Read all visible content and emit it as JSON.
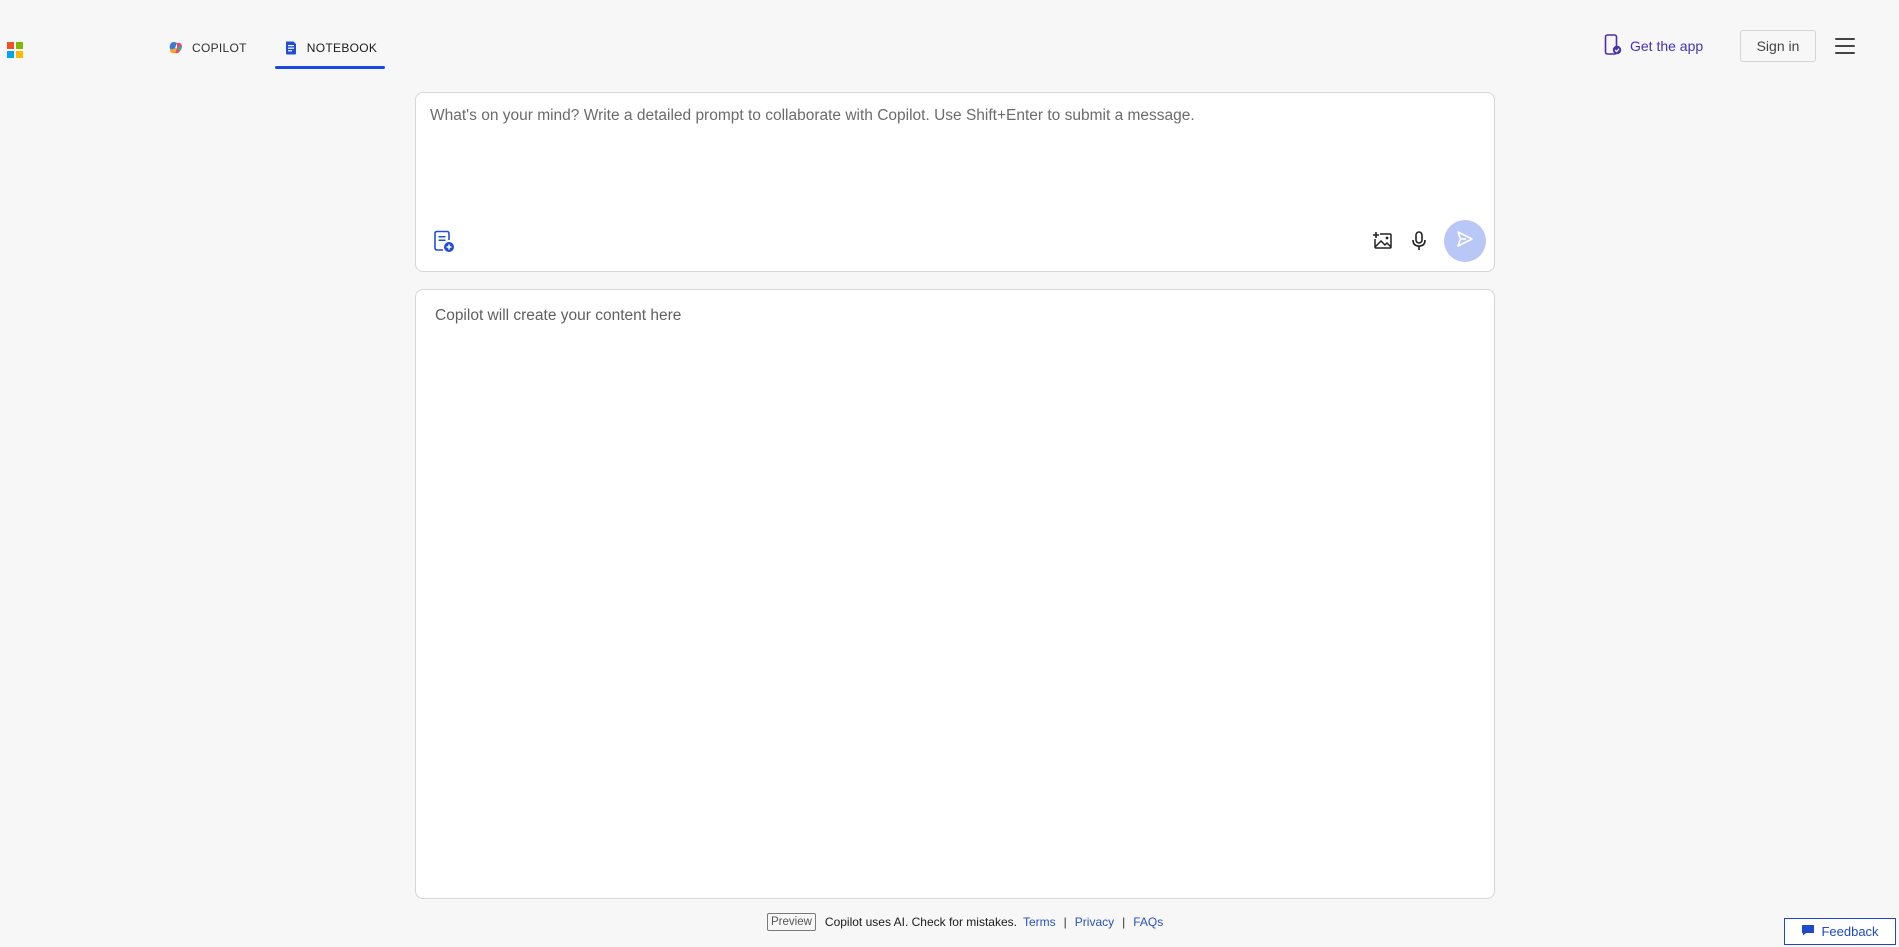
{
  "header": {
    "logo_colors": [
      "#f25022",
      "#7fba00",
      "#00a4ef",
      "#ffb900"
    ],
    "tabs": [
      {
        "label": "COPILOT",
        "icon": "copilot-icon",
        "active": false
      },
      {
        "label": "NOTEBOOK",
        "icon": "notebook-icon",
        "active": true
      }
    ],
    "get_app_label": "Get the app",
    "sign_in_label": "Sign in"
  },
  "prompt": {
    "placeholder": "What's on your mind? Write a detailed prompt to collaborate with Copilot. Use Shift+Enter to submit a message.",
    "value": ""
  },
  "content": {
    "placeholder": "Copilot will create your content here"
  },
  "footer": {
    "badge": "Preview",
    "disclaimer": "Copilot uses AI. Check for mistakes.",
    "links": [
      "Terms",
      "Privacy",
      "FAQs"
    ],
    "feedback_label": "Feedback"
  },
  "colors": {
    "accent": "#174ae4",
    "send_disabled": "#b9c7f6",
    "get_app": "#4a2fb0",
    "background": "#f7f7f7"
  }
}
